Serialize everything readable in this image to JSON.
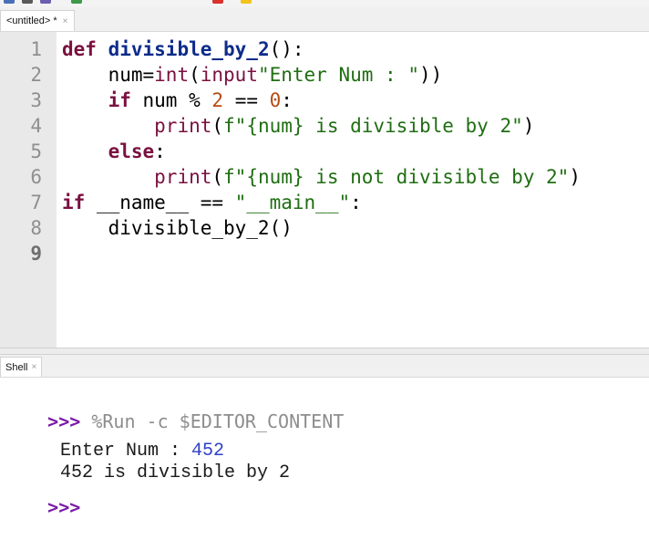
{
  "toolbar": {
    "icons": [
      "toolbar-icon-1",
      "toolbar-icon-2",
      "toolbar-icon-3",
      "toolbar-icon-4",
      "stop-icon",
      "resume-icon"
    ],
    "colors": {
      "stop": "#d9322d",
      "resume": "#f3c419"
    }
  },
  "editor_tab": {
    "label": "<untitled> *",
    "close": "×"
  },
  "editor": {
    "line_numbers": [
      "1",
      "2",
      "3",
      "4",
      "5",
      "6",
      "7",
      "8",
      "9"
    ],
    "lines": [
      [
        [
          "kw",
          "def"
        ],
        [
          "",
          "' '"
        ],
        [
          "fn",
          "divisible_by_2"
        ],
        [
          "",
          "():"
        ]
      ],
      [
        [
          "",
          "    num="
        ],
        [
          "bi",
          "int"
        ],
        [
          "",
          "("
        ],
        [
          "bi",
          "input"
        ],
        [
          "",
          ""
        ],
        [
          "st",
          "\"Enter Num : \""
        ],
        [
          "",
          "))"
        ]
      ],
      [
        [
          "",
          "    "
        ],
        [
          "kw",
          "if"
        ],
        [
          "",
          " num % "
        ],
        [
          "nm",
          "2"
        ],
        [
          "",
          " == "
        ],
        [
          "nm",
          "0"
        ],
        [
          "",
          ":"
        ]
      ],
      [
        [
          "",
          "        "
        ],
        [
          "bi",
          "print"
        ],
        [
          "",
          "("
        ],
        [
          "st",
          "f\"{num} is divisible by 2\""
        ],
        [
          "",
          ")"
        ]
      ],
      [
        [
          "",
          "    "
        ],
        [
          "kw",
          "else"
        ],
        [
          "",
          ":"
        ]
      ],
      [
        [
          "",
          "        "
        ],
        [
          "bi",
          "print"
        ],
        [
          "",
          "("
        ],
        [
          "st",
          "f\"{num} is not divisible by 2\""
        ],
        [
          "",
          ")"
        ]
      ],
      [
        [
          "kw",
          "if"
        ],
        [
          "",
          " __name__ == "
        ],
        [
          "st",
          "\"__main__\""
        ],
        [
          "",
          ":"
        ]
      ],
      [
        [
          "",
          "    divisible_by_2()"
        ]
      ],
      [
        [
          "",
          ""
        ]
      ]
    ]
  },
  "shell_tab": {
    "label": "Shell",
    "close": "×"
  },
  "shell": {
    "prompt": ">>>",
    "command": " %Run -c $EDITOR_CONTENT",
    "output_label": "Enter Num : ",
    "output_input": "452",
    "output_result": "452 is divisible by 2",
    "final_prompt": ">>>"
  }
}
